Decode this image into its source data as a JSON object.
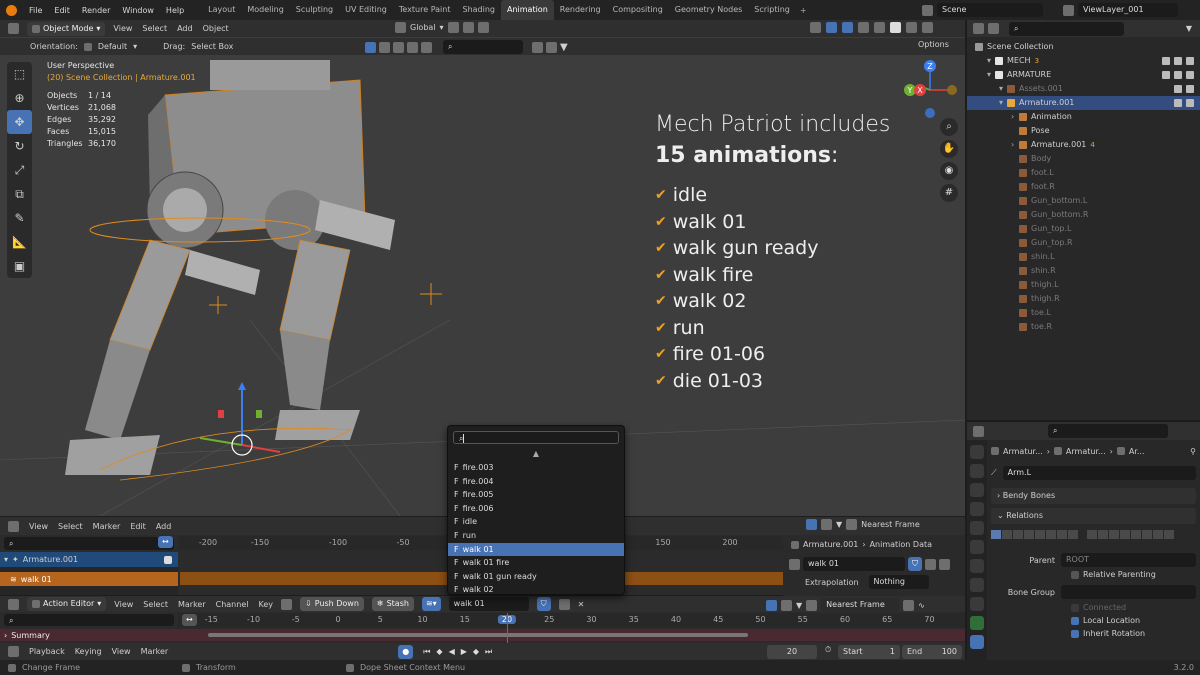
{
  "topbar": {
    "menus": [
      "File",
      "Edit",
      "Render",
      "Window",
      "Help"
    ],
    "workspaces": [
      "Layout",
      "Modeling",
      "Sculpting",
      "UV Editing",
      "Texture Paint",
      "Shading",
      "Animation",
      "Rendering",
      "Compositing",
      "Geometry Nodes",
      "Scripting"
    ],
    "active_workspace": "Animation",
    "add_tab": "+",
    "scene": "Scene",
    "view_layer": "ViewLayer_001"
  },
  "viewport_header": {
    "mode": "Object Mode",
    "menus": [
      "View",
      "Select",
      "Add",
      "Object"
    ],
    "transform_orientation": "Global",
    "orientation_label": "Orientation:",
    "orientation_value": "Default",
    "drag_label": "Drag:",
    "drag_value": "Select Box",
    "options": "Options"
  },
  "stats": {
    "view_name": "User Perspective",
    "collection": "(20) Scene Collection | Armature.001",
    "rows": [
      {
        "label": "Objects",
        "value": "1 / 14"
      },
      {
        "label": "Vertices",
        "value": "21,068"
      },
      {
        "label": "Edges",
        "value": "35,292"
      },
      {
        "label": "Faces",
        "value": "15,015"
      },
      {
        "label": "Triangles",
        "value": "36,170"
      }
    ]
  },
  "overlay": {
    "line1": "Mech Patriot includes",
    "line2_bold": "15 animations",
    "line2_rest": ":",
    "items": [
      "idle",
      "walk 01",
      "walk gun ready",
      "walk fire",
      "walk 02",
      "run",
      "fire 01-06",
      "die 01-03"
    ]
  },
  "gizmo": {
    "z": "Z",
    "y": "Y",
    "x": "X"
  },
  "outliner": {
    "root": "Scene Collection",
    "items": [
      {
        "label": "MECH",
        "depth": 1,
        "badge": "3"
      },
      {
        "label": "ARMATURE",
        "depth": 1
      },
      {
        "label": "Assets.001",
        "depth": 2,
        "dim": true
      },
      {
        "label": "Armature.001",
        "depth": 2,
        "selected": true
      },
      {
        "label": "Animation",
        "depth": 3
      },
      {
        "label": "Pose",
        "depth": 3
      },
      {
        "label": "Armature.001",
        "depth": 3,
        "badge": "4"
      },
      {
        "label": "Body",
        "depth": 3,
        "dim": true
      },
      {
        "label": "foot.L",
        "depth": 3,
        "dim": true
      },
      {
        "label": "foot.R",
        "depth": 3,
        "dim": true
      },
      {
        "label": "Gun_bottom.L",
        "depth": 3,
        "dim": true
      },
      {
        "label": "Gun_bottom.R",
        "depth": 3,
        "dim": true
      },
      {
        "label": "Gun_top.L",
        "depth": 3,
        "dim": true
      },
      {
        "label": "Gun_top.R",
        "depth": 3,
        "dim": true
      },
      {
        "label": "shin.L",
        "depth": 3,
        "dim": true
      },
      {
        "label": "shin.R",
        "depth": 3,
        "dim": true
      },
      {
        "label": "thigh.L",
        "depth": 3,
        "dim": true
      },
      {
        "label": "thigh.R",
        "depth": 3,
        "dim": true
      },
      {
        "label": "toe.L",
        "depth": 3,
        "dim": true
      },
      {
        "label": "toe.R",
        "depth": 3,
        "dim": true
      }
    ]
  },
  "properties": {
    "breadcrumb": [
      "Armatur...",
      "Armatur...",
      "Ar..."
    ],
    "bone_name": "Arm.L",
    "panel_bendy": "Bendy Bones",
    "panel_relations": "Relations",
    "parent_label": "Parent",
    "parent_value": "ROOT",
    "relative_parenting": "Relative Parenting",
    "bone_group_label": "Bone Group",
    "connected": "Connected",
    "local_location": "Local Location",
    "inherit_rotation": "Inherit Rotation"
  },
  "nla": {
    "menus": [
      "View",
      "Select",
      "Marker",
      "Edit",
      "Add"
    ],
    "snap": "Nearest Frame",
    "ruler_ticks": [
      "-200",
      "-150",
      "-100",
      "-50",
      "150",
      "200"
    ],
    "track": "Armature.001",
    "action_strip": "walk 01",
    "side_path": [
      "Armature.001",
      "Animation Data"
    ],
    "side_action": "walk 01",
    "extrapolation_label": "Extrapolation",
    "extrapolation_value": "Nothing"
  },
  "popup": {
    "items": [
      "fire.003",
      "fire.004",
      "fire.005",
      "fire.006",
      "idle",
      "run",
      "walk 01",
      "walk 01 fire",
      "walk 01 gun ready",
      "walk 02"
    ],
    "selected": "walk 01",
    "prefix": "F"
  },
  "dopesheet": {
    "mode": "Action Editor",
    "menus": [
      "View",
      "Select",
      "Marker",
      "Channel",
      "Key"
    ],
    "push_down": "Push Down",
    "stash": "Stash",
    "action": "walk 01",
    "snap": "Nearest Frame",
    "summary": "Summary",
    "ticks": [
      "-15",
      "-10",
      "-5",
      "0",
      "5",
      "10",
      "15",
      "20",
      "25",
      "30",
      "35",
      "40",
      "45",
      "50",
      "55",
      "60",
      "65",
      "70"
    ],
    "current_frame": "20"
  },
  "playback": {
    "menus": [
      "Playback",
      "Keying",
      "View",
      "Marker"
    ],
    "frame": "20",
    "start_label": "Start",
    "start": "1",
    "end_label": "End",
    "end": "100"
  },
  "statusbar": {
    "items": [
      "Change Frame",
      "Transform",
      "Dope Sheet Context Menu"
    ],
    "version": "3.2.0"
  },
  "colors": {
    "accent": "#4772b3",
    "check": "#f0a020",
    "orange": "#e6a93c",
    "track": "#b5651d"
  }
}
